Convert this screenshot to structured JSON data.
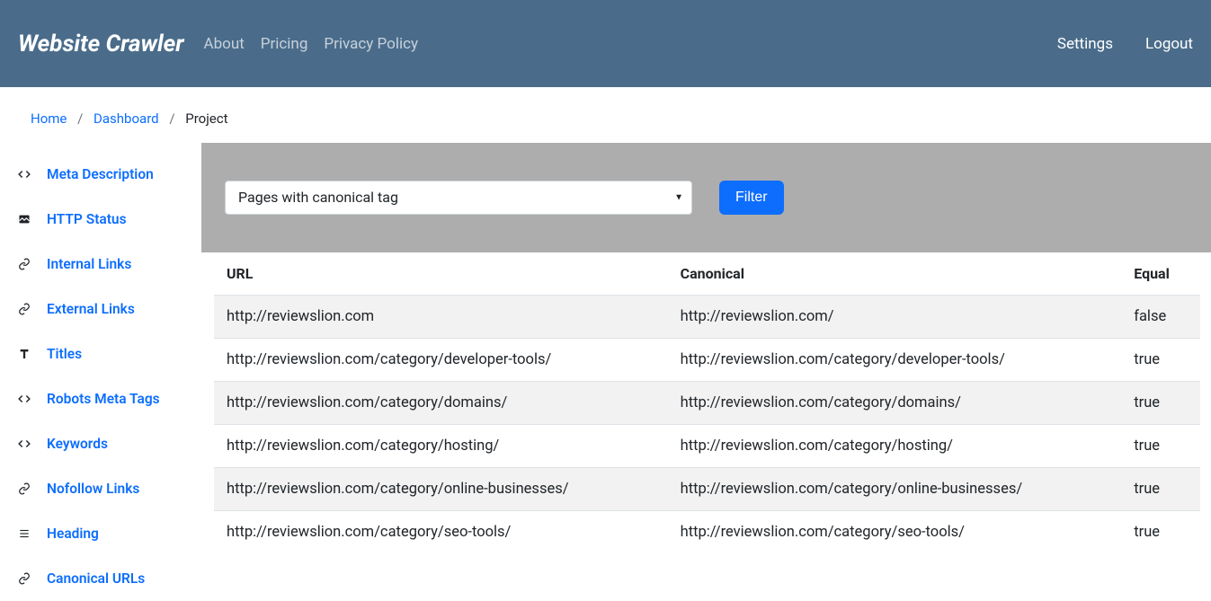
{
  "header": {
    "brand": "Website Crawler",
    "nav_left": [
      "About",
      "Pricing",
      "Privacy Policy"
    ],
    "nav_right": [
      "Settings",
      "Logout"
    ]
  },
  "breadcrumb": {
    "items": [
      "Home",
      "Dashboard"
    ],
    "current": "Project"
  },
  "sidebar": {
    "items": [
      {
        "icon": "code",
        "label": "Meta Description"
      },
      {
        "icon": "broken",
        "label": "HTTP Status"
      },
      {
        "icon": "link",
        "label": "Internal Links"
      },
      {
        "icon": "link",
        "label": "External Links"
      },
      {
        "icon": "text",
        "label": "Titles"
      },
      {
        "icon": "code",
        "label": "Robots Meta Tags"
      },
      {
        "icon": "code",
        "label": "Keywords"
      },
      {
        "icon": "link",
        "label": "Nofollow Links"
      },
      {
        "icon": "list",
        "label": "Heading"
      },
      {
        "icon": "link",
        "label": "Canonical URLs"
      }
    ]
  },
  "filter": {
    "selected": "Pages with canonical tag",
    "button": "Filter"
  },
  "table": {
    "headers": [
      "URL",
      "Canonical",
      "Equal"
    ],
    "rows": [
      {
        "url": "http://reviewslion.com",
        "canonical": "http://reviewslion.com/",
        "equal": "false"
      },
      {
        "url": "http://reviewslion.com/category/developer-tools/",
        "canonical": "http://reviewslion.com/category/developer-tools/",
        "equal": "true"
      },
      {
        "url": "http://reviewslion.com/category/domains/",
        "canonical": "http://reviewslion.com/category/domains/",
        "equal": "true"
      },
      {
        "url": "http://reviewslion.com/category/hosting/",
        "canonical": "http://reviewslion.com/category/hosting/",
        "equal": "true"
      },
      {
        "url": "http://reviewslion.com/category/online-businesses/",
        "canonical": "http://reviewslion.com/category/online-businesses/",
        "equal": "true"
      },
      {
        "url": "http://reviewslion.com/category/seo-tools/",
        "canonical": "http://reviewslion.com/category/seo-tools/",
        "equal": "true"
      }
    ]
  }
}
